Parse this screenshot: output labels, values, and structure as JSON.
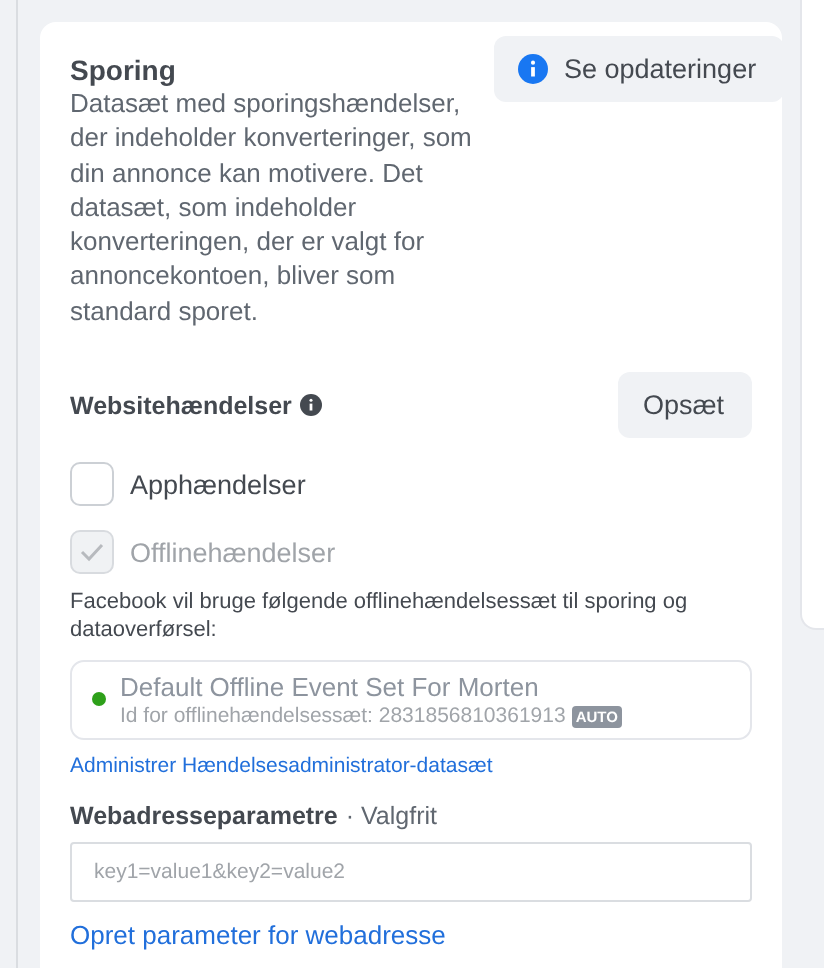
{
  "section": {
    "title": "Sporing",
    "description": "Datasæt med sporingshændelser, der indeholder konverteringer, som din annonce kan motivere. Det datasæt, som indeholder konverteringen, der er valgt for annoncekontoen, bliver som standard sporet.",
    "updates_button": "Se opdateringer"
  },
  "website_events": {
    "label": "Websitehændelser",
    "setup_button": "Opsæt"
  },
  "options": [
    {
      "label": "Apphændelser",
      "checked": false,
      "disabled": false
    },
    {
      "label": "Offlinehændelser",
      "checked": true,
      "disabled": true
    }
  ],
  "offline_note": "Facebook vil bruge følgende offlinehændelsessæt til sporing og dataoverførsel:",
  "event_set": {
    "name": "Default Offline Event Set For Morten",
    "id_text": "Id for offlinehændelsessæt: 2831856810361913",
    "badge": "AUTO",
    "color": "#2ea01a"
  },
  "manage_link": "Administrer Hændelsesadministrator-datasæt",
  "url_params": {
    "label": "Webadresseparametre",
    "optional": "· Valgfrit",
    "placeholder": "key1=value1&key2=value2"
  },
  "create_link": "Opret parameter for webadresse"
}
